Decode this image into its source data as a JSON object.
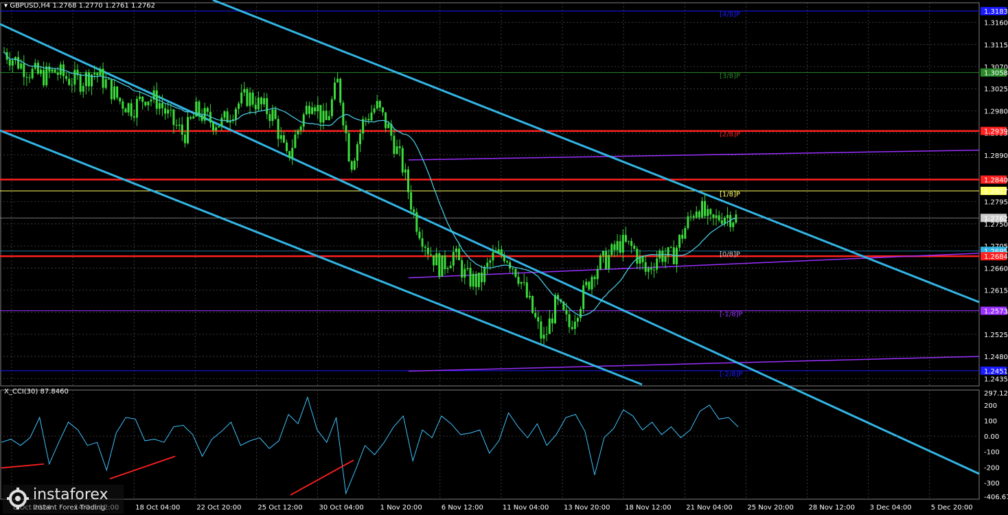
{
  "header": {
    "symbol_line": "▾ GBPUSD,H4  1.2768 1.2770 1.2761 1.2762",
    "cci_line": "X_CCI(30) 87.8460"
  },
  "watermark": {
    "brand": "instaforex",
    "tagline": "Instant Forex Trading"
  },
  "colors": {
    "background": "#000000",
    "grid": "#4a4a4a",
    "candle": "#3cdc3c",
    "channel": "#33b5e5",
    "ma": "#49c8e0",
    "support_resistance": "#ff2020",
    "murrey": "#9b30ff",
    "cci": "#3fc4ff",
    "divergence": "#ff2020"
  },
  "chart_data": [
    {
      "type": "candlestick",
      "symbol": "GBPUSD",
      "timeframe": "H4",
      "ohlc_last": [
        1.2768,
        1.277,
        1.2761,
        1.2762
      ],
      "ylim": [
        1.242,
        1.32
      ],
      "y_ticks": [
        "1.3160",
        "1.3115",
        "1.3070",
        "1.3025",
        "1.2980",
        "1.2935",
        "1.2890",
        "1.2840",
        "1.2795",
        "1.2750",
        "1.2705",
        "1.2660",
        "1.2615",
        "1.2570",
        "1.2525",
        "1.2480",
        "1.2435"
      ],
      "x_ticks": [
        "8 Oct 2024",
        "14 Oct 12:00",
        "18 Oct 04:00",
        "22 Oct 20:00",
        "25 Oct 12:00",
        "30 Oct 04:00",
        "1 Nov 20:00",
        "6 Nov 12:00",
        "11 Nov 04:00",
        "13 Nov 20:00",
        "18 Nov 12:00",
        "21 Nov 04:00",
        "25 Nov 20:00",
        "28 Nov 12:00",
        "3 Dec 04:00",
        "5 Dec 20:00"
      ],
      "close_path": [
        1.31,
        1.308,
        1.306,
        1.305,
        1.306,
        1.3045,
        1.304,
        1.306,
        1.3035,
        1.3,
        1.2985,
        1.301,
        1.3,
        1.296,
        1.293,
        1.298,
        1.296,
        1.2955,
        1.299,
        1.301,
        1.299,
        1.297,
        1.288,
        1.295,
        1.301,
        1.295,
        1.304,
        1.287,
        1.296,
        1.299,
        1.294,
        1.287,
        1.276,
        1.27,
        1.266,
        1.269,
        1.264,
        1.263,
        1.268,
        1.269,
        1.265,
        1.258,
        1.251,
        1.259,
        1.254,
        1.26,
        1.266,
        1.268,
        1.271,
        1.27,
        1.265,
        1.269,
        1.268,
        1.274,
        1.279,
        1.275,
        1.277,
        1.2762
      ],
      "price_labels": [
        {
          "text": "1.3183",
          "role": "murrey-top",
          "color": "#1a1aff"
        },
        {
          "text": "1.3058",
          "role": "murrey",
          "color": "#2a8a2a"
        },
        {
          "text": "1.2939",
          "role": "resistance",
          "color": "#ff2020"
        },
        {
          "text": "1.2840",
          "role": "resistance",
          "color": "#ff2020"
        },
        {
          "text": "1.2817",
          "role": "level",
          "color": "#ffff66"
        },
        {
          "text": "1.2762",
          "role": "current",
          "color": "#cccccc"
        },
        {
          "text": "1.2695",
          "role": "ma",
          "color": "#33b5e5"
        },
        {
          "text": "1.2684",
          "role": "support",
          "color": "#ff2020"
        },
        {
          "text": "1.2573",
          "role": "murrey",
          "color": "#9b30ff"
        },
        {
          "text": "1.2451",
          "role": "murrey-bottom",
          "color": "#1a1aff"
        }
      ],
      "murrey_labels": [
        "[4/8]P",
        "[3/8]P",
        "[2/8]P",
        "[1/8]P",
        "[0/8]P",
        "[-1/8]P",
        "[-2/8]P"
      ]
    },
    {
      "type": "line",
      "name": "X_CCI(30)",
      "value": 87.846,
      "ylim": [
        -406.677,
        297.1248
      ],
      "y_ticks": [
        "297.1248",
        "200",
        "100",
        "0.00",
        "-100",
        "-200",
        "-300",
        "-406.677"
      ],
      "values": [
        -40,
        -20,
        -60,
        -10,
        120,
        -180,
        -40,
        90,
        40,
        -60,
        -40,
        -220,
        20,
        120,
        110,
        -30,
        -20,
        -40,
        60,
        70,
        10,
        -130,
        -20,
        30,
        90,
        -60,
        -30,
        -10,
        -80,
        -30,
        140,
        80,
        250,
        40,
        -40,
        120,
        -370,
        -220,
        -60,
        -120,
        -40,
        60,
        130,
        -160,
        40,
        -10,
        130,
        80,
        10,
        20,
        40,
        -110,
        -30,
        150,
        60,
        -10,
        80,
        -60,
        10,
        120,
        140,
        30,
        -250,
        -10,
        50,
        170,
        130,
        40,
        90,
        10,
        60,
        -10,
        40,
        160,
        200,
        110,
        120,
        60
      ],
      "divergence_lines": 4
    }
  ]
}
